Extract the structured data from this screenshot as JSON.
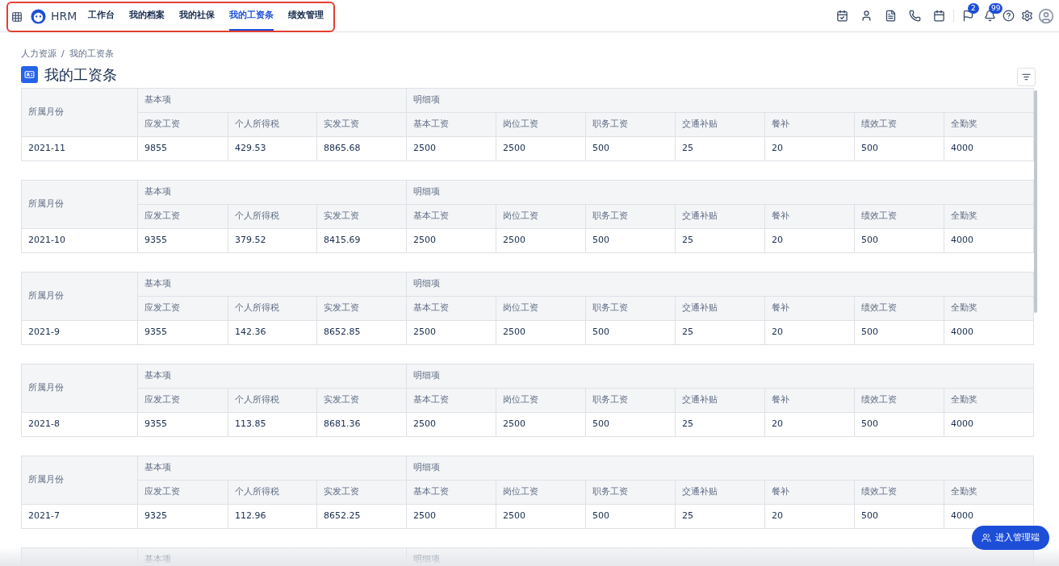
{
  "app": {
    "name": "HRM"
  },
  "nav": [
    {
      "label": "工作台",
      "selected": false
    },
    {
      "label": "我的档案",
      "selected": false
    },
    {
      "label": "我的社保",
      "selected": false
    },
    {
      "label": "我的工资条",
      "selected": true
    },
    {
      "label": "绩效管理",
      "selected": false
    }
  ],
  "toolbar": {
    "badges": [
      "2",
      "99"
    ]
  },
  "breadcrumb": [
    "人力资源",
    "/",
    "我的工资条"
  ],
  "page_title": "我的工资条",
  "slips": [
    {
      "month_header": "所属月份",
      "groups": [
        "基本项",
        "明细项"
      ],
      "columns": [
        "应发工资",
        "个人所得税",
        "实发工资",
        "基本工资",
        "岗位工资",
        "职务工资",
        "交通补贴",
        "餐补",
        "绩效工资",
        "全勤奖"
      ],
      "month": "2021-11",
      "values": [
        "9855",
        "429.53",
        "8865.68",
        "2500",
        "2500",
        "500",
        "25",
        "20",
        "500",
        "4000"
      ]
    },
    {
      "month_header": "所属月份",
      "groups": [
        "基本项",
        "明细项"
      ],
      "columns": [
        "应发工资",
        "个人所得税",
        "实发工资",
        "基本工资",
        "岗位工资",
        "职务工资",
        "交通补贴",
        "餐补",
        "绩效工资",
        "全勤奖"
      ],
      "month": "2021-10",
      "values": [
        "9355",
        "379.52",
        "8415.69",
        "2500",
        "2500",
        "500",
        "25",
        "20",
        "500",
        "4000"
      ]
    },
    {
      "month_header": "所属月份",
      "groups": [
        "基本项",
        "明细项"
      ],
      "columns": [
        "应发工资",
        "个人所得税",
        "实发工资",
        "基本工资",
        "岗位工资",
        "职务工资",
        "交通补贴",
        "餐补",
        "绩效工资",
        "全勤奖"
      ],
      "month": "2021-9",
      "values": [
        "9355",
        "142.36",
        "8652.85",
        "2500",
        "2500",
        "500",
        "25",
        "20",
        "500",
        "4000"
      ]
    },
    {
      "month_header": "所属月份",
      "groups": [
        "基本项",
        "明细项"
      ],
      "columns": [
        "应发工资",
        "个人所得税",
        "实发工资",
        "基本工资",
        "岗位工资",
        "职务工资",
        "交通补贴",
        "餐补",
        "绩效工资",
        "全勤奖"
      ],
      "month": "2021-8",
      "values": [
        "9355",
        "113.85",
        "8681.36",
        "2500",
        "2500",
        "500",
        "25",
        "20",
        "500",
        "4000"
      ]
    },
    {
      "month_header": "所属月份",
      "groups": [
        "基本项",
        "明细项"
      ],
      "columns": [
        "应发工资",
        "个人所得税",
        "实发工资",
        "基本工资",
        "岗位工资",
        "职务工资",
        "交通补贴",
        "餐补",
        "绩效工资",
        "全勤奖"
      ],
      "month": "2021-7",
      "values": [
        "9325",
        "112.96",
        "8652.25",
        "2500",
        "2500",
        "500",
        "25",
        "20",
        "500",
        "4000"
      ]
    },
    {
      "groups": [
        "基本项",
        "明细项"
      ]
    }
  ],
  "admin_button": "进入管理端"
}
